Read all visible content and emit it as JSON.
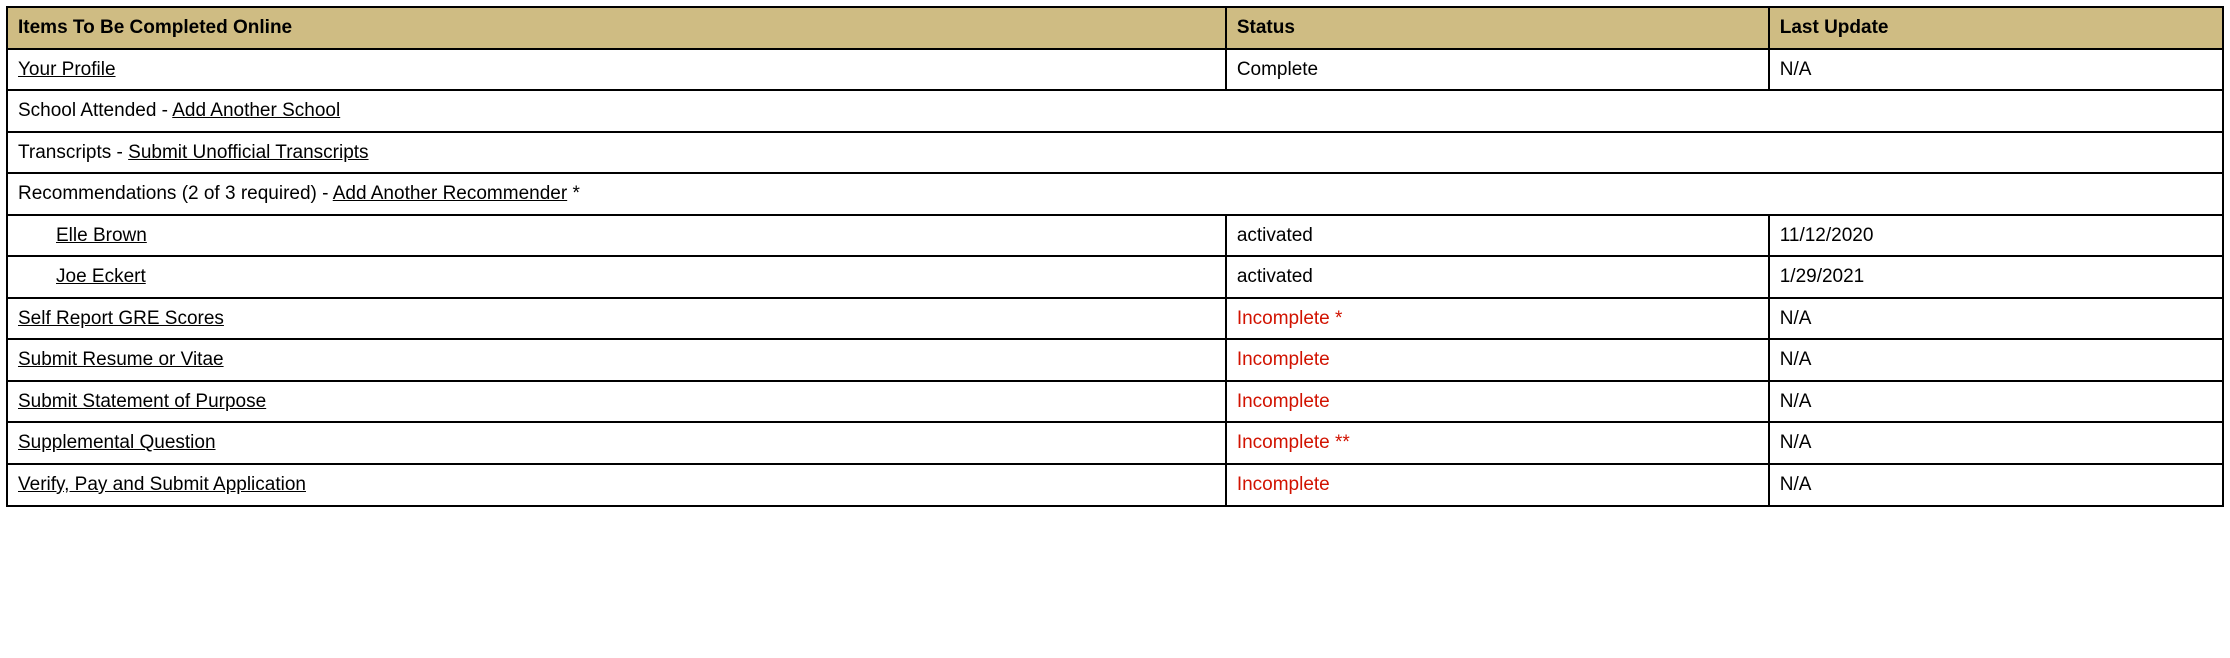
{
  "headers": {
    "items": "Items To Be Completed Online",
    "status": "Status",
    "update": "Last Update"
  },
  "rows": {
    "profile": {
      "link": "Your Profile",
      "status": "Complete",
      "update": "N/A"
    },
    "school": {
      "prefix": "School Attended - ",
      "link": "Add Another School"
    },
    "transcripts": {
      "prefix": "Transcripts - ",
      "link": "Submit Unofficial Transcripts"
    },
    "recommendations": {
      "prefix": "Recommendations (2 of 3 required) - ",
      "link": "Add Another Recommender",
      "suffix": " *"
    },
    "rec1": {
      "link": "Elle Brown",
      "status": "activated",
      "update": "11/12/2020"
    },
    "rec2": {
      "link": "Joe Eckert",
      "status": "activated",
      "update": "1/29/2021"
    },
    "gre": {
      "link": "Self Report GRE Scores",
      "status": "Incomplete *",
      "update": "N/A"
    },
    "resume": {
      "link": "Submit Resume or Vitae",
      "status": "Incomplete",
      "update": "N/A"
    },
    "sop": {
      "link": "Submit Statement of Purpose",
      "status": "Incomplete",
      "update": "N/A"
    },
    "supplemental": {
      "link": "Supplemental Question",
      "status": "Incomplete **",
      "update": "N/A"
    },
    "verify": {
      "link": "Verify, Pay and Submit Application",
      "status": "Incomplete",
      "update": "N/A"
    }
  }
}
